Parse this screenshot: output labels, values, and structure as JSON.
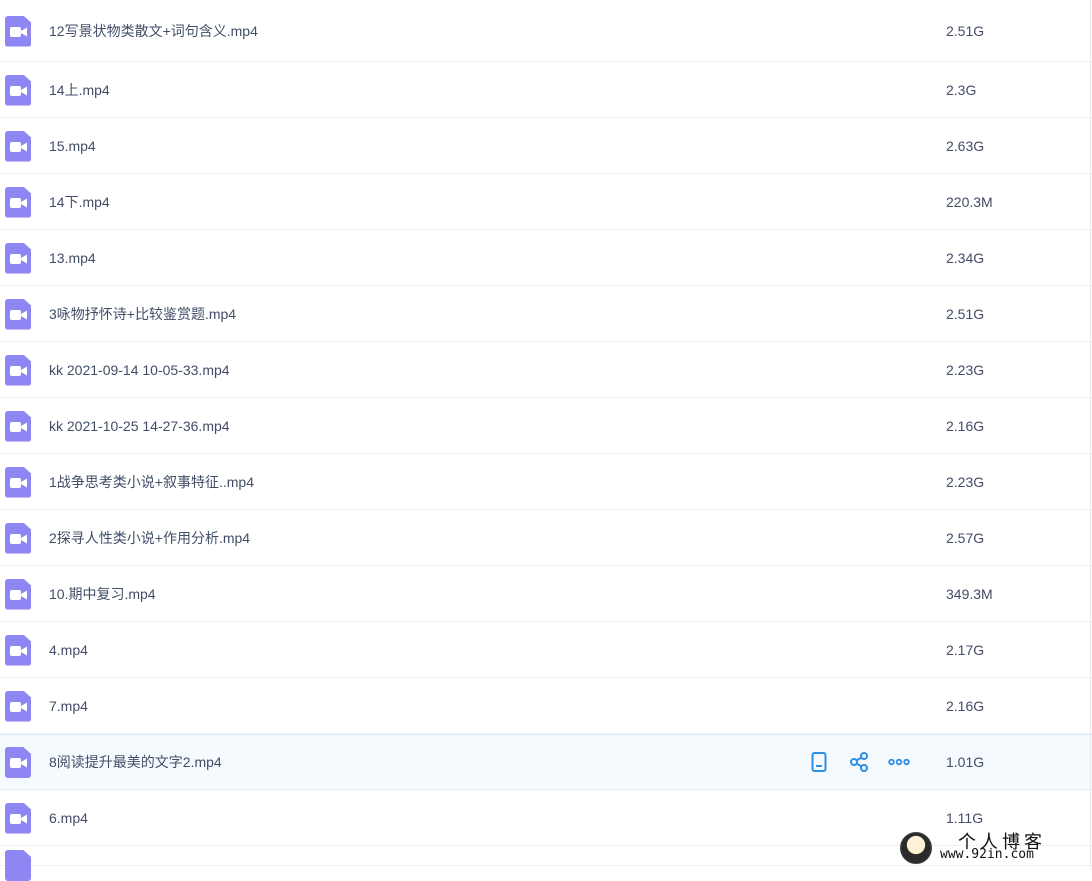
{
  "files": [
    {
      "name": "12写景状物类散文+词句含义.mp4",
      "size": "2.51G"
    },
    {
      "name": "14上.mp4",
      "size": "2.3G"
    },
    {
      "name": "15.mp4",
      "size": "2.63G"
    },
    {
      "name": "14下.mp4",
      "size": "220.3M"
    },
    {
      "name": "13.mp4",
      "size": "2.34G"
    },
    {
      "name": "3咏物抒怀诗+比较鉴赏题.mp4",
      "size": "2.51G"
    },
    {
      "name": "kk 2021-09-14 10-05-33.mp4",
      "size": "2.23G"
    },
    {
      "name": "kk 2021-10-25 14-27-36.mp4",
      "size": "2.16G"
    },
    {
      "name": "1战争思考类小说+叙事特征..mp4",
      "size": "2.23G"
    },
    {
      "name": "2探寻人性类小说+作用分析.mp4",
      "size": "2.57G"
    },
    {
      "name": "10.期中复习.mp4",
      "size": "349.3M"
    },
    {
      "name": "4.mp4",
      "size": "2.17G"
    },
    {
      "name": "7.mp4",
      "size": "2.16G"
    },
    {
      "name": "8阅读提升最美的文字2.mp4",
      "size": "1.01G"
    },
    {
      "name": "6.mp4",
      "size": "1.11G"
    }
  ],
  "hovered_row_index": 13,
  "row_actions": [
    "phone-icon",
    "share-icon",
    "more-icon"
  ],
  "file_icon": "video-file-icon",
  "colors": {
    "icon": "#8e86f2",
    "action": "#2d8ee6",
    "hover_bg": "#f5faff",
    "text": "#424e67"
  },
  "watermark": {
    "title": "个人博客",
    "url": "www.92in.com"
  }
}
